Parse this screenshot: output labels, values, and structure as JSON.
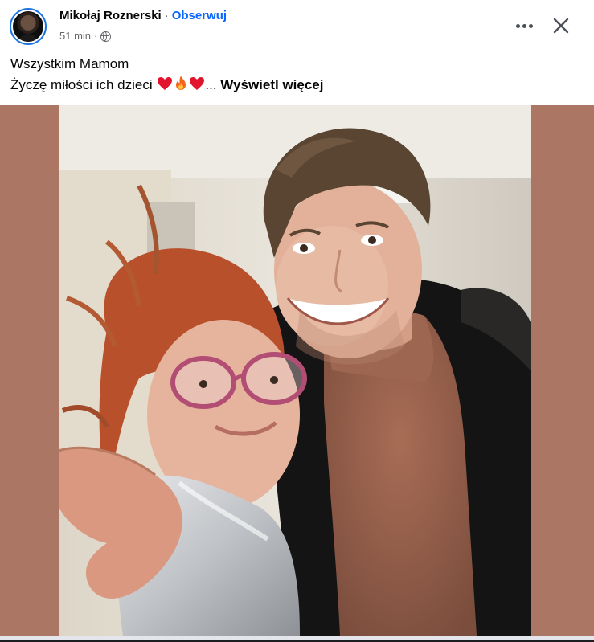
{
  "post": {
    "author": "Mikołaj Roznerski",
    "separator": "·",
    "follow_label": "Obserwuj",
    "time": "51 min",
    "meta_separator": "·",
    "audience_icon": "globe-icon",
    "more_icon": "more-options-icon",
    "close_icon": "close-icon",
    "text_line1": "Wszystkim Mamom",
    "text_line2": "Życzę miłości ich dzieci",
    "emoji_icons": [
      "heart-icon",
      "fire-icon",
      "heart-icon"
    ],
    "ellipsis": "...",
    "see_more_label": "Wyświetl więcej",
    "photo_description_icon": "photo"
  },
  "colors": {
    "follow_blue": "#0866ff",
    "avatar_ring": "#1b74e4",
    "media_background": "#ab7663",
    "meta_gray": "#65676b"
  }
}
